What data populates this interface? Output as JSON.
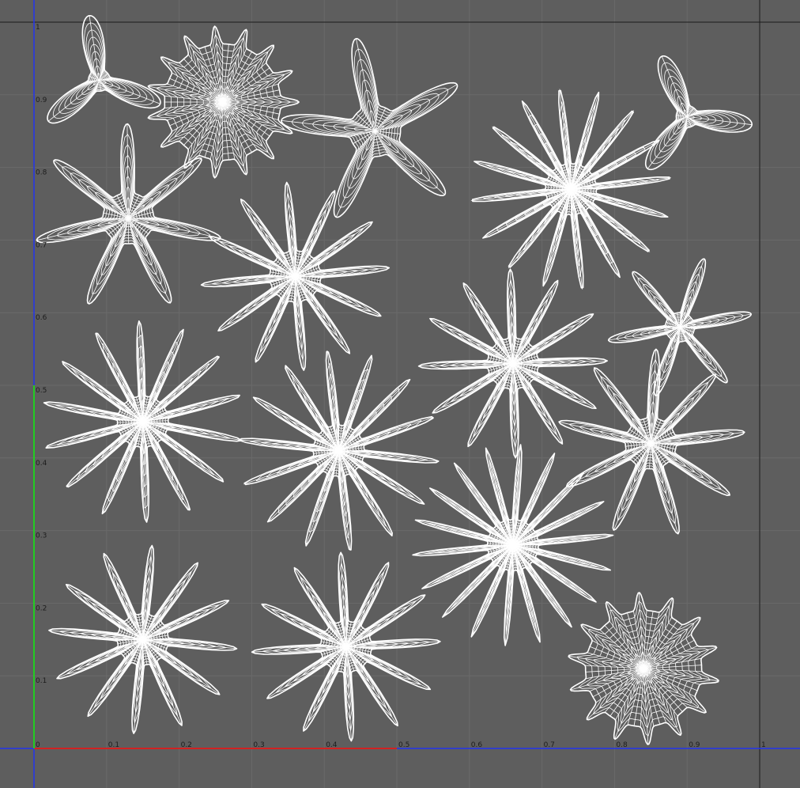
{
  "editor": {
    "name": "UV Editor",
    "background": "#5e5e5e",
    "grid_color": "#6a6a6a",
    "axis_u_color": "#d12222",
    "axis_v_color": "#22cc22",
    "axis_blue_color": "#2233ee",
    "wire_color": "#ffffff"
  },
  "axes": {
    "u_ticks": [
      "0",
      "0.1",
      "0.2",
      "0.3",
      "0.4",
      "0.5",
      "0.6",
      "0.7",
      "0.8",
      "0.9",
      "1"
    ],
    "v_ticks": [
      "1",
      "0.9",
      "0.8",
      "0.7",
      "0.6",
      "0.5",
      "0.4",
      "0.3",
      "0.2",
      "0.1",
      "0"
    ]
  },
  "uv_shells": [
    {
      "id": "shell-star-top-left",
      "u": 0.26,
      "v": 0.89,
      "petals": 15,
      "type": "star"
    },
    {
      "id": "shell-tri-top-left",
      "u": 0.09,
      "v": 0.92,
      "petals": 3,
      "type": "tri"
    },
    {
      "id": "shell-flower-5-top",
      "u": 0.47,
      "v": 0.85,
      "petals": 5,
      "type": "flower"
    },
    {
      "id": "shell-flower-8-upper-left",
      "u": 0.13,
      "v": 0.73,
      "petals": 7,
      "type": "flower"
    },
    {
      "id": "shell-flower-12-center-top",
      "u": 0.36,
      "v": 0.65,
      "petals": 12,
      "type": "flower"
    },
    {
      "id": "shell-flower-16-top-right",
      "u": 0.74,
      "v": 0.77,
      "petals": 16,
      "type": "flower"
    },
    {
      "id": "shell-tri-top-right",
      "u": 0.9,
      "v": 0.87,
      "petals": 3,
      "type": "tri"
    },
    {
      "id": "shell-flower-12-center-right",
      "u": 0.66,
      "v": 0.53,
      "petals": 12,
      "type": "flower"
    },
    {
      "id": "shell-spiky-right",
      "u": 0.89,
      "v": 0.58,
      "petals": 6,
      "type": "spiky"
    },
    {
      "id": "shell-flower-14-left",
      "u": 0.15,
      "v": 0.45,
      "petals": 14,
      "type": "flower"
    },
    {
      "id": "shell-flower-14-center",
      "u": 0.42,
      "v": 0.41,
      "petals": 14,
      "type": "flower"
    },
    {
      "id": "shell-flower-9-right",
      "u": 0.85,
      "v": 0.42,
      "petals": 9,
      "type": "flower"
    },
    {
      "id": "shell-flower-18-center-low",
      "u": 0.66,
      "v": 0.28,
      "petals": 18,
      "type": "flower"
    },
    {
      "id": "shell-flower-12-bottom-left",
      "u": 0.15,
      "v": 0.15,
      "petals": 12,
      "type": "flower"
    },
    {
      "id": "shell-flower-12-bottom-center",
      "u": 0.43,
      "v": 0.14,
      "petals": 12,
      "type": "flower"
    },
    {
      "id": "shell-star-bottom-right",
      "u": 0.84,
      "v": 0.11,
      "petals": 14,
      "type": "star"
    }
  ]
}
